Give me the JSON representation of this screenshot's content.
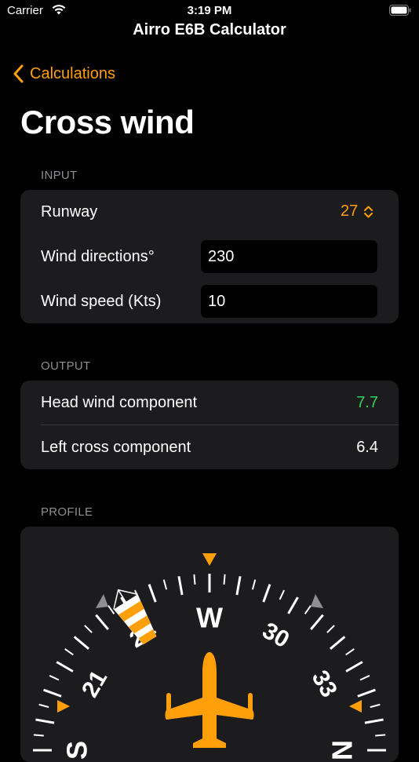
{
  "status_bar": {
    "carrier": "Carrier",
    "time": "3:19 PM"
  },
  "app_title": "Airro E6B Calculator",
  "nav": {
    "back_label": "Calculations"
  },
  "page_title": "Cross wind",
  "input": {
    "header": "INPUT",
    "runway_label": "Runway",
    "runway_value": "27",
    "wind_direction_label": "Wind directions°",
    "wind_direction_value": "230",
    "wind_speed_label": "Wind speed (Kts)",
    "wind_speed_value": "10"
  },
  "output": {
    "header": "OUTPUT",
    "head_wind_label": "Head wind component",
    "head_wind_value": "7.7",
    "cross_label": "Left cross component",
    "cross_value": "6.4"
  },
  "profile": {
    "header": "PROFILE",
    "heading_deg": 270,
    "wind_from_deg": 230,
    "compass_labels": [
      "S",
      "21",
      "24",
      "W",
      "30",
      "33",
      "N"
    ],
    "colors": {
      "accent": "#FF9F0A",
      "positive": "#30D158",
      "card": "#1c1c1e",
      "secondary": "#8e8e93"
    }
  }
}
